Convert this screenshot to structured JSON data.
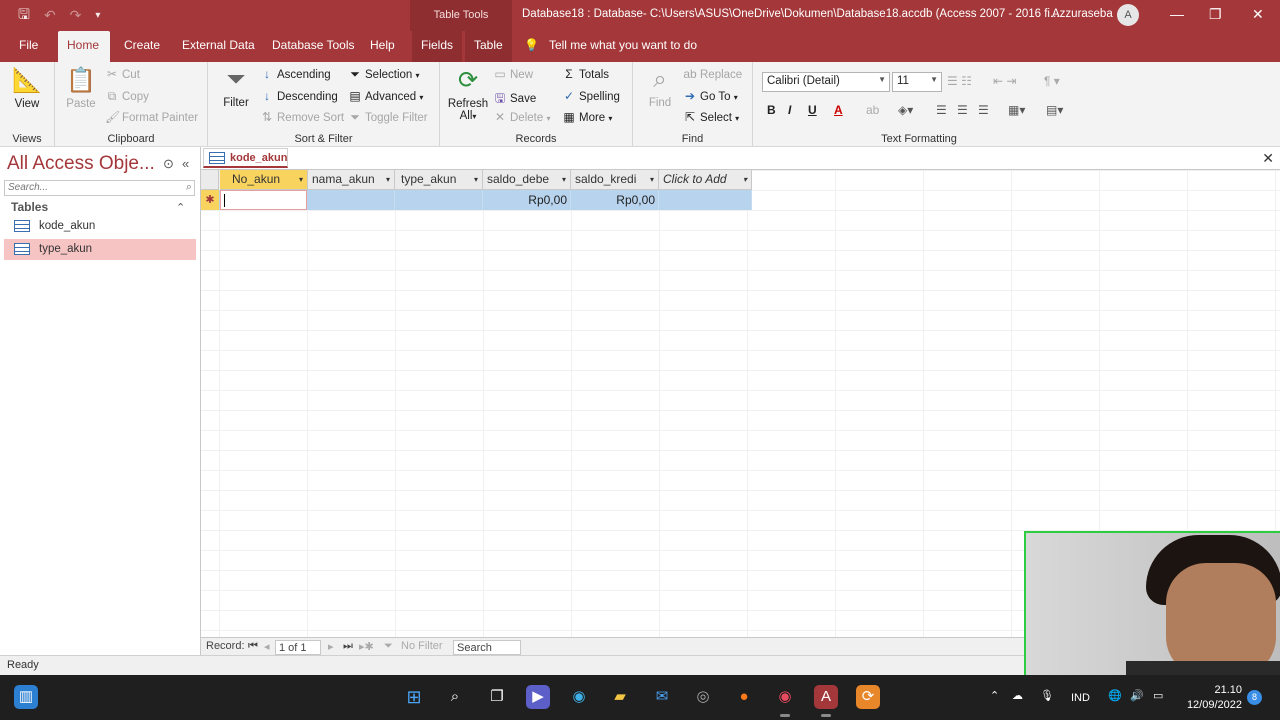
{
  "window": {
    "context_label": "Table Tools",
    "title": "Database18 : Database- C:\\Users\\ASUS\\OneDrive\\Dokumen\\Database18.accdb (Access 2007 - 2016 fi...",
    "user": "Azzuraseba",
    "avatar_initial": "A"
  },
  "tabs": [
    "File",
    "Home",
    "Create",
    "External Data",
    "Database Tools",
    "Help",
    "Fields",
    "Table"
  ],
  "tell_me": "Tell me what you want to do",
  "ribbon": {
    "views": {
      "view": "View",
      "label": "Views"
    },
    "clipboard": {
      "paste": "Paste",
      "cut": "Cut",
      "copy": "Copy",
      "format_painter": "Format Painter",
      "label": "Clipboard"
    },
    "sort_filter": {
      "filter": "Filter",
      "ascending": "Ascending",
      "descending": "Descending",
      "remove_sort": "Remove Sort",
      "selection": "Selection",
      "advanced": "Advanced",
      "toggle_filter": "Toggle Filter",
      "label": "Sort & Filter"
    },
    "records": {
      "refresh": "Refresh",
      "refresh_all": "All",
      "new": "New",
      "save": "Save",
      "delete": "Delete",
      "totals": "Totals",
      "spelling": "Spelling",
      "more": "More",
      "label": "Records"
    },
    "find": {
      "find": "Find",
      "replace": "Replace",
      "goto": "Go To",
      "select": "Select",
      "label": "Find"
    },
    "text_formatting": {
      "font": "Calibri (Detail)",
      "size": "11",
      "bold": "B",
      "italic": "I",
      "underline": "U",
      "label": "Text Formatting"
    }
  },
  "nav": {
    "title": "All Access Obje...",
    "search_placeholder": "Search...",
    "section": "Tables",
    "items": [
      {
        "label": "kode_akun",
        "selected": false
      },
      {
        "label": "type_akun",
        "selected": true
      }
    ]
  },
  "document": {
    "tab": "kode_akun",
    "columns": [
      "No_akun",
      "nama_akun",
      "type_akun",
      "saldo_debe",
      "saldo_kredi",
      "Click to Add"
    ],
    "new_row": [
      "",
      "",
      "",
      "Rp0,00",
      "Rp0,00",
      ""
    ],
    "record_nav": {
      "label": "Record:",
      "position": "1 of 1",
      "filter": "No Filter",
      "search": "Search"
    }
  },
  "status": "Ready",
  "taskbar": {
    "lang": "IND",
    "time": "21.10",
    "date": "12/09/2022",
    "notifications": "8"
  },
  "colors": {
    "accent": "#a4373a",
    "selected_row": "#b7d3ee",
    "key_header": "#f8d45f"
  }
}
